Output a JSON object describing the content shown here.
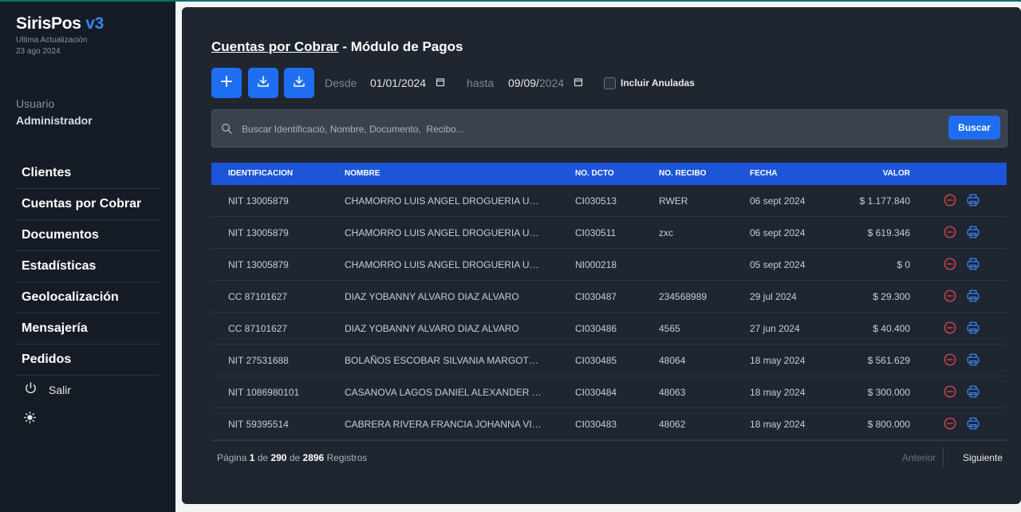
{
  "app": {
    "name": "SirisPos",
    "version": "v3",
    "updated_label": "Ultima Actualización",
    "updated_date": "23 ago 2024"
  },
  "user": {
    "label": "Usuario",
    "name": "Administrador"
  },
  "sidebar": {
    "items": [
      {
        "label": "Clientes"
      },
      {
        "label": "Cuentas por Cobrar"
      },
      {
        "label": "Documentos"
      },
      {
        "label": "Estadísticas"
      },
      {
        "label": "Geolocalización"
      },
      {
        "label": "Mensajería"
      },
      {
        "label": "Pedidos"
      }
    ],
    "logout_label": "Salir",
    "logout_icon": "power-icon",
    "theme_icon": "sun-icon"
  },
  "page": {
    "title_link": "Cuentas por Cobrar",
    "title_rest": " - Módulo de Pagos"
  },
  "toolbar": {
    "add_icon": "plus-icon",
    "download_icon": "download-icon",
    "from_label": "Desde",
    "from_date_dd": "01",
    "from_date_mm": "01",
    "from_date_yyyy": "2024",
    "to_label": "hasta",
    "to_date_dd": "09",
    "to_date_mm": "09",
    "to_date_yyyy": "2024",
    "include_void_label": "Incluir Anuladas",
    "include_void_checked": false
  },
  "search": {
    "placeholder": "Buscar Identificació, Nombre, Documento,  Recibo...",
    "value": "",
    "button_label": "Buscar"
  },
  "table": {
    "headers": {
      "id": "IDENTIFICACION",
      "nombre": "NOMBRE",
      "dcto": "NO. DCTO",
      "recibo": "NO. RECIBO",
      "fecha": "FECHA",
      "valor": "VALOR"
    },
    "rows": [
      {
        "id": "NIT 13005879",
        "nombre": "CHAMORRO LUIS ANGEL DROGUERIA UNIDAD",
        "dcto": "CI030513",
        "recibo": "RWER",
        "fecha": "06 sept 2024",
        "valor": "$ 1.177.840"
      },
      {
        "id": "NIT 13005879",
        "nombre": "CHAMORRO LUIS ANGEL DROGUERIA UNIDAD",
        "dcto": "CI030511",
        "recibo": "zxc",
        "fecha": "06 sept 2024",
        "valor": "$ 619.346"
      },
      {
        "id": "NIT 13005879",
        "nombre": "CHAMORRO LUIS ANGEL DROGUERIA UNIDAD",
        "dcto": "NI000218",
        "recibo": "",
        "fecha": "05 sept 2024",
        "valor": "$ 0"
      },
      {
        "id": "CC 87101627",
        "nombre": "DIAZ YOBANNY ALVARO DIAZ ALVARO",
        "dcto": "CI030487",
        "recibo": "234568989",
        "fecha": "29 jul 2024",
        "valor": "$ 29.300"
      },
      {
        "id": "CC 87101627",
        "nombre": "DIAZ YOBANNY ALVARO DIAZ ALVARO",
        "dcto": "CI030486",
        "recibo": "4565",
        "fecha": "27 jun 2024",
        "valor": "$ 40.400"
      },
      {
        "id": "NIT 27531688",
        "nombre": "BOLAÑOS ESCOBAR SILVANIA MARGOTH DROGUERIA",
        "dcto": "CI030485",
        "recibo": "48064",
        "fecha": "18 may 2024",
        "valor": "$ 561.629"
      },
      {
        "id": "NIT 1086980101",
        "nombre": "CASANOVA LAGOS DANIEL ALEXANDER DROGUERIA",
        "dcto": "CI030484",
        "recibo": "48063",
        "fecha": "18 may 2024",
        "valor": "$ 300.000"
      },
      {
        "id": "NIT 59395514",
        "nombre": "CABRERA RIVERA FRANCIA JOHANNA VILLA",
        "dcto": "CI030483",
        "recibo": "48062",
        "fecha": "18 may 2024",
        "valor": "$ 800.000"
      }
    ],
    "row_actions": [
      "void-icon",
      "print-icon"
    ]
  },
  "pagination": {
    "page_label": "Página",
    "page": "1",
    "of_label": "de",
    "total_pages": "290",
    "records_total": "2896",
    "records_label": "Registros",
    "prev_label": "Anterior",
    "next_label": "Siguiente"
  },
  "colors": {
    "accent": "#1e6ef2",
    "table_header": "#1d55d8",
    "sidebar_bg": "#161c26",
    "panel_bg": "#1f2630",
    "danger": "#e0454b",
    "print": "#3b82f6"
  }
}
